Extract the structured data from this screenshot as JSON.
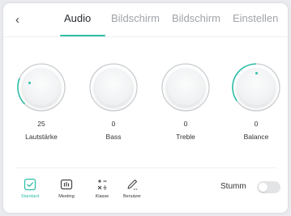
{
  "header": {
    "back_icon": "chevron-left-icon",
    "back_glyph": "‹",
    "tabs": [
      {
        "label": "Audio",
        "active": true
      },
      {
        "label": "Bildschirm",
        "active": false
      },
      {
        "label": "Bildschirm",
        "active": false
      },
      {
        "label": "Einstellen",
        "active": false
      }
    ]
  },
  "knobs": [
    {
      "value": "25",
      "label": "Lautstärke"
    },
    {
      "value": "0",
      "label": "Bass"
    },
    {
      "value": "0",
      "label": "Treble"
    },
    {
      "value": "0",
      "label": "Balance"
    }
  ],
  "modes": [
    {
      "label": "Standard",
      "icon": "checkbox-icon",
      "active": true
    },
    {
      "label": "Meeting",
      "icon": "meeting-icon",
      "active": false
    },
    {
      "label": "Klasse",
      "icon": "math-operators-icon",
      "active": false
    },
    {
      "label": "Benutzer",
      "icon": "pencil-icon",
      "active": false
    }
  ],
  "mute": {
    "label": "Stumm",
    "on": false
  },
  "colors": {
    "accent": "#2dbfa8",
    "track": "#c9cdd1",
    "text": "#2a2d31",
    "inactive_tab": "#a0a3a8"
  }
}
